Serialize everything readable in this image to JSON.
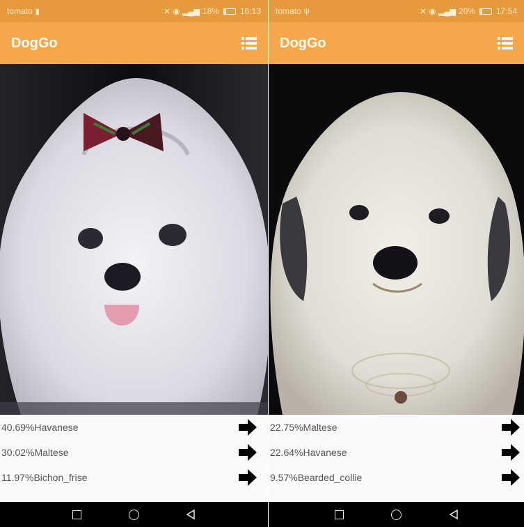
{
  "screens": [
    {
      "status": {
        "carrier": "tomato",
        "battery_percent": "18%",
        "battery_level": 0.18,
        "time": "16:13"
      },
      "appbar": {
        "title": "DogGo"
      },
      "results": [
        {
          "label": "40.69%Havanese"
        },
        {
          "label": "30.02%Maltese"
        },
        {
          "label": "11.97%Bichon_frise"
        }
      ]
    },
    {
      "status": {
        "carrier": "tomato",
        "battery_percent": "20%",
        "battery_level": 0.2,
        "time": "17:54"
      },
      "appbar": {
        "title": "DogGo"
      },
      "results": [
        {
          "label": "22.75%Maltese"
        },
        {
          "label": "22.64%Havanese"
        },
        {
          "label": "9.57%Bearded_collie"
        }
      ]
    }
  ],
  "icons": {
    "menu": "list-menu-icon",
    "result_action": "arrow-right-icon",
    "nav": [
      "square-recents-icon",
      "circle-home-icon",
      "triangle-back-icon"
    ]
  },
  "colors": {
    "statusbar": "#e69a3b",
    "appbar": "#f4a84a",
    "navbar": "#000000",
    "result_text": "#555555"
  }
}
